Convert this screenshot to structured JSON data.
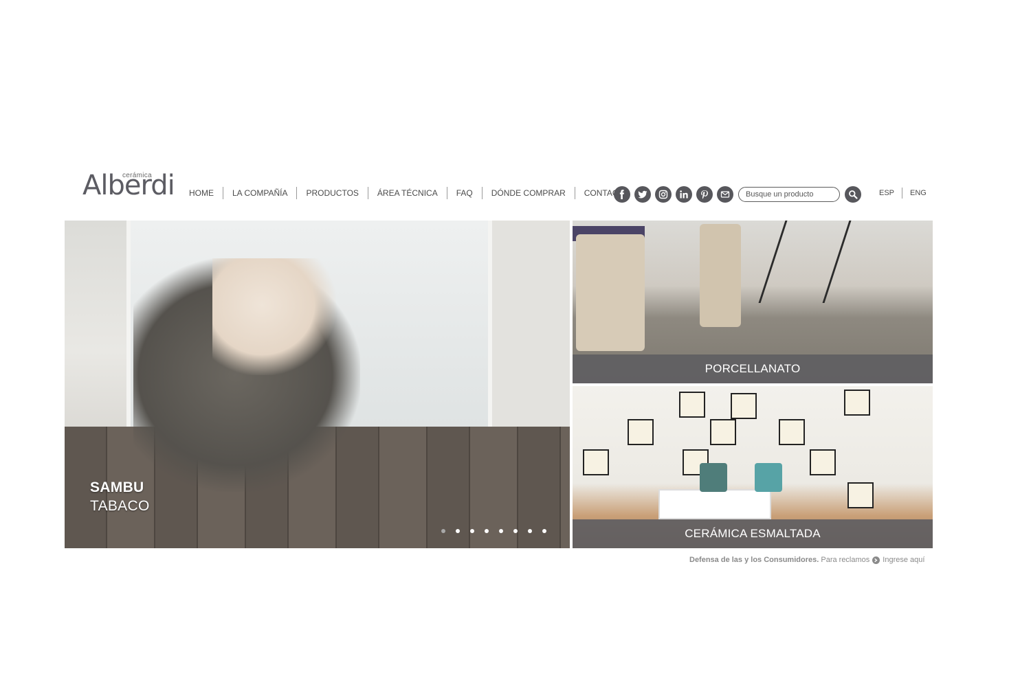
{
  "logo": {
    "small": "cerámica",
    "main": "Alberdi"
  },
  "nav": [
    "HOME",
    "LA COMPAÑÍA",
    "PRODUCTOS",
    "ÁREA TÉCNICA",
    "FAQ",
    "DÓNDE COMPRAR",
    "CONTACTO"
  ],
  "social_icons": [
    "facebook-icon",
    "twitter-icon",
    "instagram-icon",
    "linkedin-icon",
    "pinterest-icon",
    "mail-icon"
  ],
  "search": {
    "placeholder": "Busque un producto"
  },
  "languages": [
    "ESP",
    "ENG"
  ],
  "hero": {
    "title": "SAMBU",
    "subtitle": "TABACO",
    "slide_count": 8,
    "active_slide": 1
  },
  "tiles": [
    {
      "label": "PORCELLANATO"
    },
    {
      "label": "CERÁMICA ESMALTADA"
    }
  ],
  "footer": {
    "bold": "Defensa de las y los Consumidores.",
    "text": "Para reclamos",
    "link": "Ingrese aquí"
  },
  "colors": {
    "icon_bg": "#57575c",
    "label_bg": "#5f5e62",
    "text": "#4a4a4a"
  }
}
